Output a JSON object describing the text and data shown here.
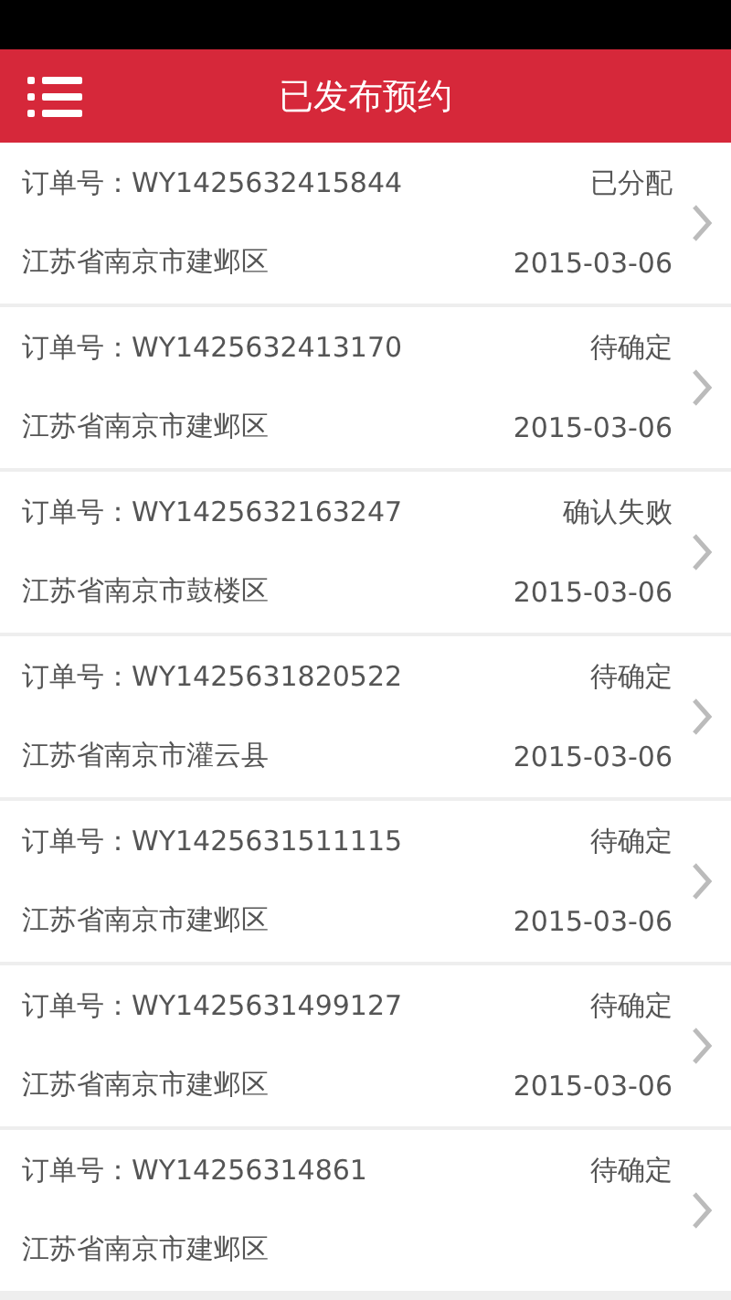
{
  "header": {
    "title": "已发布预约"
  },
  "orders": [
    {
      "order_no": "订单号：WY1425632415844",
      "status": "已分配",
      "address": "江苏省南京市建邺区",
      "date": "2015-03-06"
    },
    {
      "order_no": "订单号：WY1425632413170",
      "status": "待确定",
      "address": "江苏省南京市建邺区",
      "date": "2015-03-06"
    },
    {
      "order_no": "订单号：WY1425632163247",
      "status": "确认失败",
      "address": "江苏省南京市鼓楼区",
      "date": "2015-03-06"
    },
    {
      "order_no": "订单号：WY1425631820522",
      "status": "待确定",
      "address": "江苏省南京市灌云县",
      "date": "2015-03-06"
    },
    {
      "order_no": "订单号：WY1425631511115",
      "status": "待确定",
      "address": "江苏省南京市建邺区",
      "date": "2015-03-06"
    },
    {
      "order_no": "订单号：WY1425631499127",
      "status": "待确定",
      "address": "江苏省南京市建邺区",
      "date": "2015-03-06"
    },
    {
      "order_no": "订单号：WY14256314861",
      "status": "待确定",
      "address": "江苏省南京市建邺区"
    }
  ]
}
